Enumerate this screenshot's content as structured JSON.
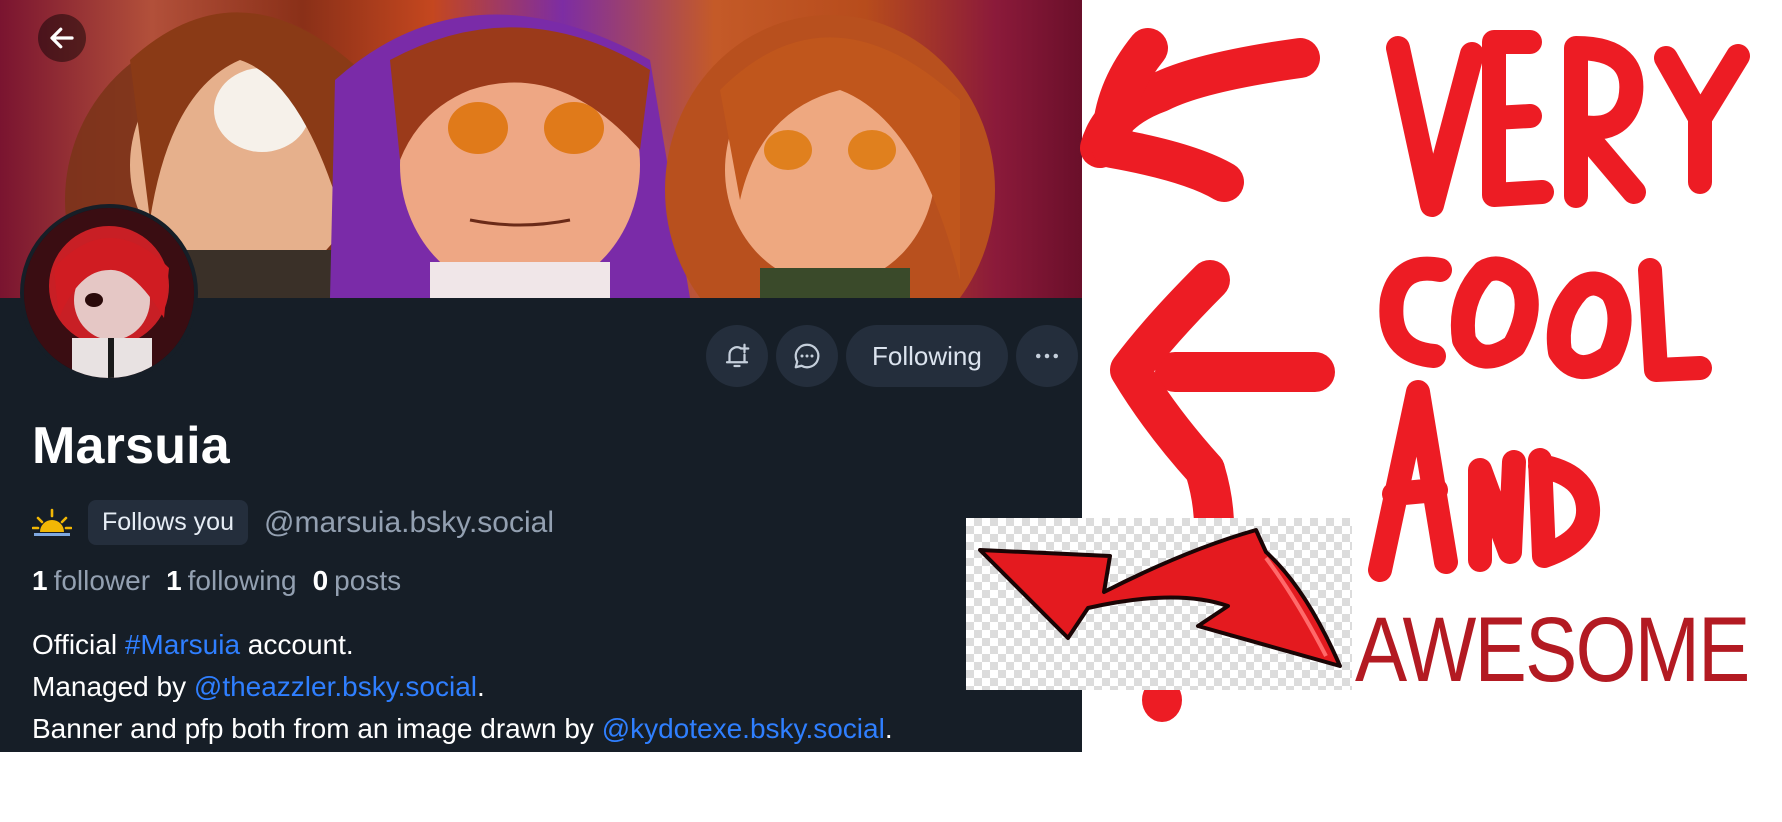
{
  "profile": {
    "display_name": "Marsuia",
    "follows_you_badge": "Follows you",
    "handle": "@marsuia.bsky.social",
    "stats": {
      "followers_count": "1",
      "followers_label": "follower",
      "following_count": "1",
      "following_label": "following",
      "posts_count": "0",
      "posts_label": "posts"
    },
    "bio": {
      "line1_prefix": "Official ",
      "line1_hashtag": "#Marsuia",
      "line1_suffix": " account.",
      "line2_prefix": "Managed by ",
      "line2_mention": "@theazzler.bsky.social",
      "line2_suffix": ".",
      "line3_prefix": "Banner and pfp both from an image drawn by ",
      "line3_mention": "@kydotexe.bsky.social",
      "line3_suffix": "."
    }
  },
  "actions": {
    "following_label": "Following",
    "notify_icon": "bell-plus-icon",
    "message_icon": "chat-bubble-icon",
    "more_icon": "ellipsis-icon"
  },
  "navigation": {
    "back_icon": "arrow-left-icon"
  },
  "annotation": {
    "handwritten_words": [
      "VERY",
      "COOL",
      "AND"
    ],
    "typed_word": "AWESOME"
  },
  "colors": {
    "panel_background": "#161e27",
    "button_background": "#242e3c",
    "link": "#2f7fff",
    "annotation_red": "#ed1c24",
    "awesome_text": "#b31a22"
  }
}
